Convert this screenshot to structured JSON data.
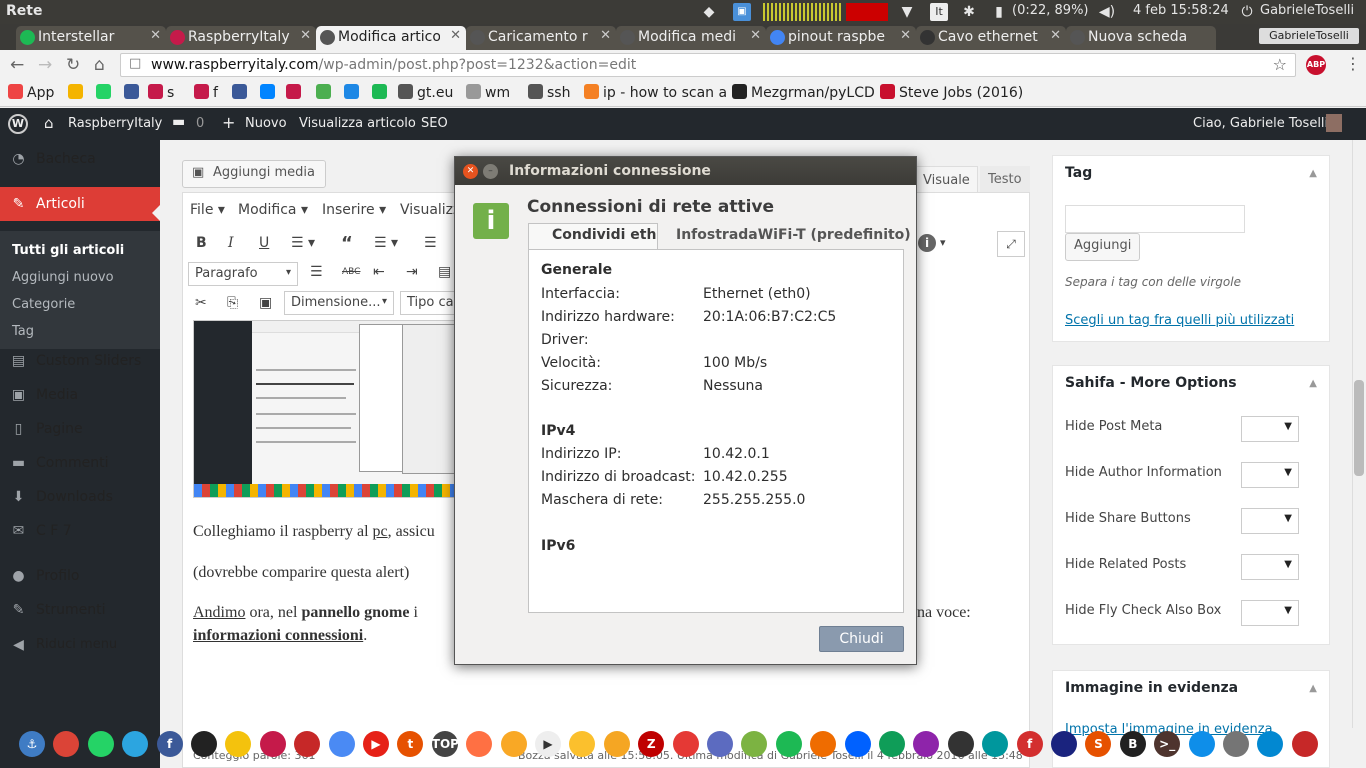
{
  "os_panel": {
    "title": "Rete",
    "battery": "(0:22, 89%)",
    "keyboard": "It",
    "datetime": "4 feb 15:58:24",
    "user": "GabrieleToselli"
  },
  "browser": {
    "profile_badge": "GabrieleToselli",
    "tabs": [
      {
        "label": "Interstellar",
        "color": "#1db954"
      },
      {
        "label": "RaspberryItaly",
        "color": "#c51a4a"
      },
      {
        "label": "Modifica artico",
        "color": "#555555"
      },
      {
        "label": "Caricamento r",
        "color": "#555555"
      },
      {
        "label": "Modifica medi",
        "color": "#555555"
      },
      {
        "label": "pinout raspbe",
        "color": "#4285f4"
      },
      {
        "label": "Cavo ethernet",
        "color": "#333333"
      },
      {
        "label": "Nuova scheda",
        "color": "#555555"
      }
    ],
    "url_host": "www.raspberryitaly.com",
    "url_path": "/wp-admin/post.php?post=1232&action=edit",
    "abp": "ABP",
    "bookmarks": [
      {
        "label": "App",
        "color": "#e44"
      },
      {
        "label": "",
        "color": "#f4b400"
      },
      {
        "label": "",
        "color": "#25d366"
      },
      {
        "label": "",
        "color": "#3b5998"
      },
      {
        "label": "s",
        "color": "#c51a4a"
      },
      {
        "label": "f",
        "color": "#c51a4a"
      },
      {
        "label": "",
        "color": "#3b5998"
      },
      {
        "label": "",
        "color": "#0084ff"
      },
      {
        "label": "",
        "color": "#c51a4a"
      },
      {
        "label": "",
        "color": "#4caf50"
      },
      {
        "label": "",
        "color": "#1e88e5"
      },
      {
        "label": "",
        "color": "#1db954"
      },
      {
        "label": "gt.eu",
        "color": "#555"
      },
      {
        "label": "wm",
        "color": "#999"
      },
      {
        "label": "ssh",
        "color": "#555"
      },
      {
        "label": "ip - how to scan a",
        "color": "#f48024"
      },
      {
        "label": "Mezgrman/pyLCD",
        "color": "#222"
      },
      {
        "label": "Steve Jobs (2016)",
        "color": "#c8102e"
      }
    ]
  },
  "wp_bar": {
    "site": "RaspberryItaly",
    "comments": "0",
    "new": "Nuovo",
    "view": "Visualizza articolo",
    "seo": "SEO",
    "greeting": "Ciao, Gabriele Toselli"
  },
  "wp_menu": {
    "items": [
      {
        "label": "Bacheca"
      },
      {
        "label": "Articoli"
      },
      {
        "label": "Custom Sliders"
      },
      {
        "label": "Media"
      },
      {
        "label": "Pagine"
      },
      {
        "label": "Commenti"
      },
      {
        "label": "Downloads"
      },
      {
        "label": "C F 7"
      },
      {
        "label": "Profilo"
      },
      {
        "label": "Strumenti"
      },
      {
        "label": "Riduci menu"
      }
    ],
    "submenu": [
      "Tutti gli articoli",
      "Aggiungi nuovo",
      "Categorie",
      "Tag"
    ]
  },
  "editor": {
    "add_media": "Aggiungi media",
    "tab_visual": "Visuale",
    "tab_text": "Testo",
    "menus": [
      "File",
      "Modifica",
      "Inserire",
      "Visualizza"
    ],
    "format_select": "Paragrafo",
    "font_size_select": "Dimensione...",
    "font_family_select": "Tipo ca",
    "para1_pre": "Colleghiamo il raspberry al ",
    "para1_pc": "pc",
    "para1_post": ", assicu",
    "para2": "(dovrebbe comparire questa alert)",
    "para3_a": "Andimo",
    "para3_b": " ora, nel ",
    "para3_c": "pannello gnome",
    "para3_d": " i",
    "para3_end": "na voce:",
    "para4_a": "informazioni connessioni",
    "para4_b": ".",
    "status": "Conteggio parole: 361",
    "status_right": "Bozza salvata alle 15:58:05. Ultima modifica di Gabriele Toselli il 4 febbraio 2016 alle 15:48"
  },
  "right": {
    "tag_title": "Tag",
    "tag_add": "Aggiungi",
    "tag_hint": "Separa i tag con delle virgole",
    "tag_link": "Scegli un tag fra quelli più utilizzati",
    "sahifa_title": "Sahifa - More Options",
    "options": [
      "Hide Post Meta",
      "Hide Author Information",
      "Hide Share Buttons",
      "Hide Related Posts",
      "Hide Fly Check Also Box"
    ],
    "featured_title": "Immagine in evidenza",
    "featured_link": "Imposta l'immagine in evidenza"
  },
  "dialog": {
    "title": "Informazioni connessione",
    "heading": "Connessioni di rete attive",
    "tab1": "Condividi eth",
    "tab2": "InfostradaWiFi-T (predefinito)",
    "sec_general": "Generale",
    "rows": [
      {
        "k": "Interfaccia:",
        "v": "Ethernet (eth0)"
      },
      {
        "k": "Indirizzo hardware:",
        "v": "20:1A:06:B7:C2:C5"
      },
      {
        "k": "Driver:",
        "v": ""
      },
      {
        "k": "Velocità:",
        "v": "100 Mb/s"
      },
      {
        "k": "Sicurezza:",
        "v": "Nessuna"
      }
    ],
    "sec_ipv4": "IPv4",
    "ipv4": [
      {
        "k": "Indirizzo IP:",
        "v": "10.42.0.1"
      },
      {
        "k": "Indirizzo di broadcast:",
        "v": "10.42.0.255"
      },
      {
        "k": "Maschera di rete:",
        "v": "255.255.255.0"
      }
    ],
    "sec_ipv6": "IPv6",
    "close": "Chiudi"
  },
  "dock": [
    {
      "name": "anchor-icon",
      "color": "#3f7cc4",
      "glyph": "⚓"
    },
    {
      "name": "chrome-icon",
      "color": "#db4437",
      "glyph": ""
    },
    {
      "name": "whatsapp-icon",
      "color": "#25d366",
      "glyph": ""
    },
    {
      "name": "telegram-icon",
      "color": "#2ca5e0",
      "glyph": ""
    },
    {
      "name": "facebook-icon",
      "color": "#3b5998",
      "glyph": "f"
    },
    {
      "name": "github-icon",
      "color": "#222222",
      "glyph": ""
    },
    {
      "name": "bulb-icon",
      "color": "#f4c20d",
      "glyph": ""
    },
    {
      "name": "raspberry-icon",
      "color": "#c51a4a",
      "glyph": ""
    },
    {
      "name": "app-red-icon",
      "color": "#c62828",
      "glyph": ""
    },
    {
      "name": "docs-icon",
      "color": "#4a8af4",
      "glyph": ""
    },
    {
      "name": "youtube-icon",
      "color": "#e62117",
      "glyph": "▶"
    },
    {
      "name": "t-icon",
      "color": "#e65100",
      "glyph": "t"
    },
    {
      "name": "top-icon",
      "color": "#444444",
      "glyph": "TOP"
    },
    {
      "name": "camera-icon",
      "color": "#ff7043",
      "glyph": ""
    },
    {
      "name": "bird-icon",
      "color": "#f9a825",
      "glyph": ""
    },
    {
      "name": "play-icon",
      "color": "#eeeeee",
      "glyph": "▶"
    },
    {
      "name": "linux-icon",
      "color": "#fbc02d",
      "glyph": ""
    },
    {
      "name": "folder-icon",
      "color": "#f5a623",
      "glyph": ""
    },
    {
      "name": "filezilla-icon",
      "color": "#bf0000",
      "glyph": "Z"
    },
    {
      "name": "flask-icon",
      "color": "#e53935",
      "glyph": ""
    },
    {
      "name": "bluetooth-icon",
      "color": "#5c6bc0",
      "glyph": ""
    },
    {
      "name": "toggle-icon",
      "color": "#7cb342",
      "glyph": ""
    },
    {
      "name": "spotify-icon",
      "color": "#1db954",
      "glyph": ""
    },
    {
      "name": "fox-icon",
      "color": "#ef6c00",
      "glyph": ""
    },
    {
      "name": "dropbox-icon",
      "color": "#0061ff",
      "glyph": ""
    },
    {
      "name": "sheet-icon",
      "color": "#0f9d58",
      "glyph": ""
    },
    {
      "name": "headphones-icon",
      "color": "#8e24aa",
      "glyph": ""
    },
    {
      "name": "tux-icon",
      "color": "#333333",
      "glyph": ""
    },
    {
      "name": "arduino-icon",
      "color": "#00979d",
      "glyph": ""
    },
    {
      "name": "f-red-icon",
      "color": "#d32f2f",
      "glyph": "f"
    },
    {
      "name": "globe-icon",
      "color": "#1a237e",
      "glyph": ""
    },
    {
      "name": "s-icon",
      "color": "#e65100",
      "glyph": "S"
    },
    {
      "name": "b-icon",
      "color": "#212121",
      "glyph": "B"
    },
    {
      "name": "terminal-icon",
      "color": "#4e342e",
      "glyph": ">_"
    },
    {
      "name": "teamviewer-icon",
      "color": "#0e8ee9",
      "glyph": ""
    },
    {
      "name": "drive-icon",
      "color": "#757575",
      "glyph": ""
    },
    {
      "name": "monitor-icon",
      "color": "#0288d1",
      "glyph": ""
    },
    {
      "name": "trash-icon",
      "color": "#c62828",
      "glyph": ""
    }
  ]
}
